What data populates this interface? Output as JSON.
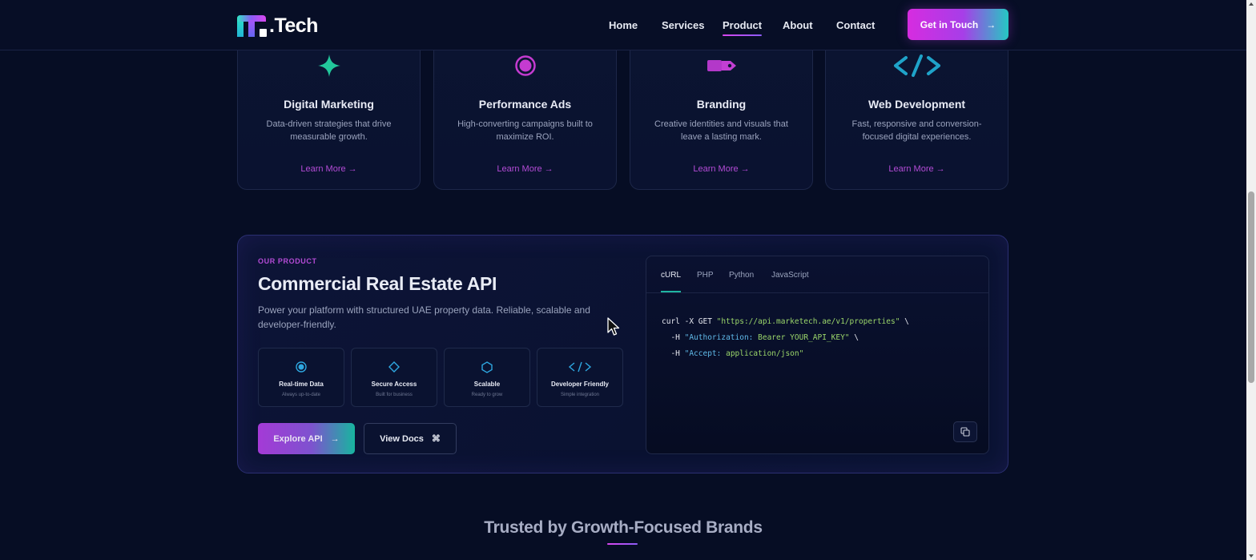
{
  "brand": {
    "logo_text": ".Tech"
  },
  "nav": {
    "items": [
      {
        "label": "Home"
      },
      {
        "label": "Services"
      },
      {
        "label": "Product"
      },
      {
        "label": "About"
      },
      {
        "label": "Contact"
      }
    ],
    "cta_label": "Get in Touch",
    "cta_arrow": "→"
  },
  "services": [
    {
      "icon": "sparkle-icon",
      "title": "Digital Marketing",
      "desc": "Data-driven strategies that drive measurable growth.",
      "link": "Learn More →"
    },
    {
      "icon": "target-icon",
      "title": "Performance Ads",
      "desc": "High-converting campaigns built to maximize ROI.",
      "link": "Learn More →"
    },
    {
      "icon": "pen-nib-icon",
      "title": "Branding",
      "desc": "Creative identities and visuals that leave a lasting mark.",
      "link": "Learn More →"
    },
    {
      "icon": "code-icon",
      "title": "Web Development",
      "desc": "Fast, responsive and conversion-focused digital experiences.",
      "link": "Learn More →"
    }
  ],
  "product": {
    "eyebrow": "OUR PRODUCT",
    "title": "Commercial Real Estate API",
    "description": "Power your platform with structured UAE property data. Reliable, scalable and developer-friendly.",
    "features": [
      {
        "icon": "radio-dot-icon",
        "label": "Real-time Data",
        "sub": "Always up-to-date"
      },
      {
        "icon": "diamond-icon",
        "label": "Secure Access",
        "sub": "Built for business"
      },
      {
        "icon": "hexagon-icon",
        "label": "Scalable",
        "sub": "Ready to grow"
      },
      {
        "icon": "code-icon",
        "label": "Developer Friendly",
        "sub": "Simple integration"
      }
    ],
    "primary_button": "Explore API",
    "primary_arrow": "→",
    "secondary_button": "View Docs",
    "secondary_glyph": "⌘",
    "code_tabs": [
      "cURL",
      "PHP",
      "Python",
      "JavaScript"
    ],
    "active_tab": "cURL",
    "code": {
      "line1_cmd": "curl -X GET ",
      "line1_url": "\"https://api.marketech.ae/v1/properties\"",
      "line1_end": " \\",
      "line2_flag": "  -H ",
      "line2_key": "\"Authorization: ",
      "line2_val": "Bearer YOUR_API_KEY\"",
      "line2_end": " \\",
      "line3_flag": "  -H ",
      "line3_key": "\"Accept: ",
      "line3_val": "application/json\""
    }
  },
  "trusted": {
    "title": "Trusted by Growth-Focused Brands"
  },
  "colors": {
    "accent_magenta": "#d946ef",
    "accent_teal": "#22c7b8",
    "background": "#060d24"
  }
}
